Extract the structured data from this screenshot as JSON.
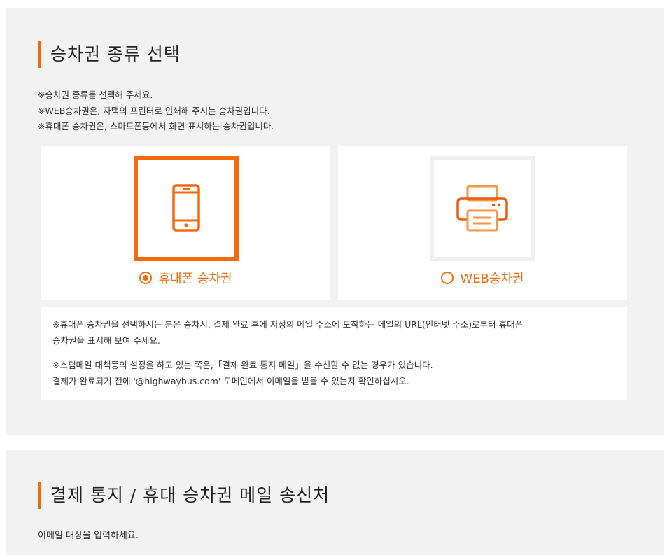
{
  "ticket_section": {
    "title": "승차권 종류 선택",
    "notes": [
      "※승차권 종류를 선택해 주세요.",
      "※WEB승차권은, 자택의 프린터로 인쇄해 주시는 승차권입니다.",
      "※휴대폰 승차권은, 스마트폰등에서 화면 표시하는 승차권입니다."
    ],
    "options": [
      {
        "label": "휴대폰 승차권",
        "icon": "smartphone-icon",
        "selected": true
      },
      {
        "label": "WEB승차권",
        "icon": "printer-icon",
        "selected": false
      }
    ],
    "info": [
      "※휴대폰 승차권을 선택하시는 분은 승차시, 결제 완료 후에 지정의 메일 주소에 도착하는 메일의 URL(인터넷 주소)로부터 휴대폰",
      "승차권을 표시해 보여 주세요.",
      "※스팸메일 대책등의 설정을 하고 있는 쪽은,「결제 완료 통지 메일」을 수신할 수 없는 경우가 있습니다.",
      "결제가 완료되기 전에 '@highwaybus.com' 도메인에서 이메일을 받을 수 있는지 확인하십시오."
    ]
  },
  "email_section": {
    "title": "결제 통지 / 휴대 승차권 메일 송신처",
    "label": "이메일 대상을 입력하세요."
  },
  "colors": {
    "accent": "#f26a0e",
    "panel_bg": "#f2f2f2",
    "unselected_border": "#efefef"
  }
}
